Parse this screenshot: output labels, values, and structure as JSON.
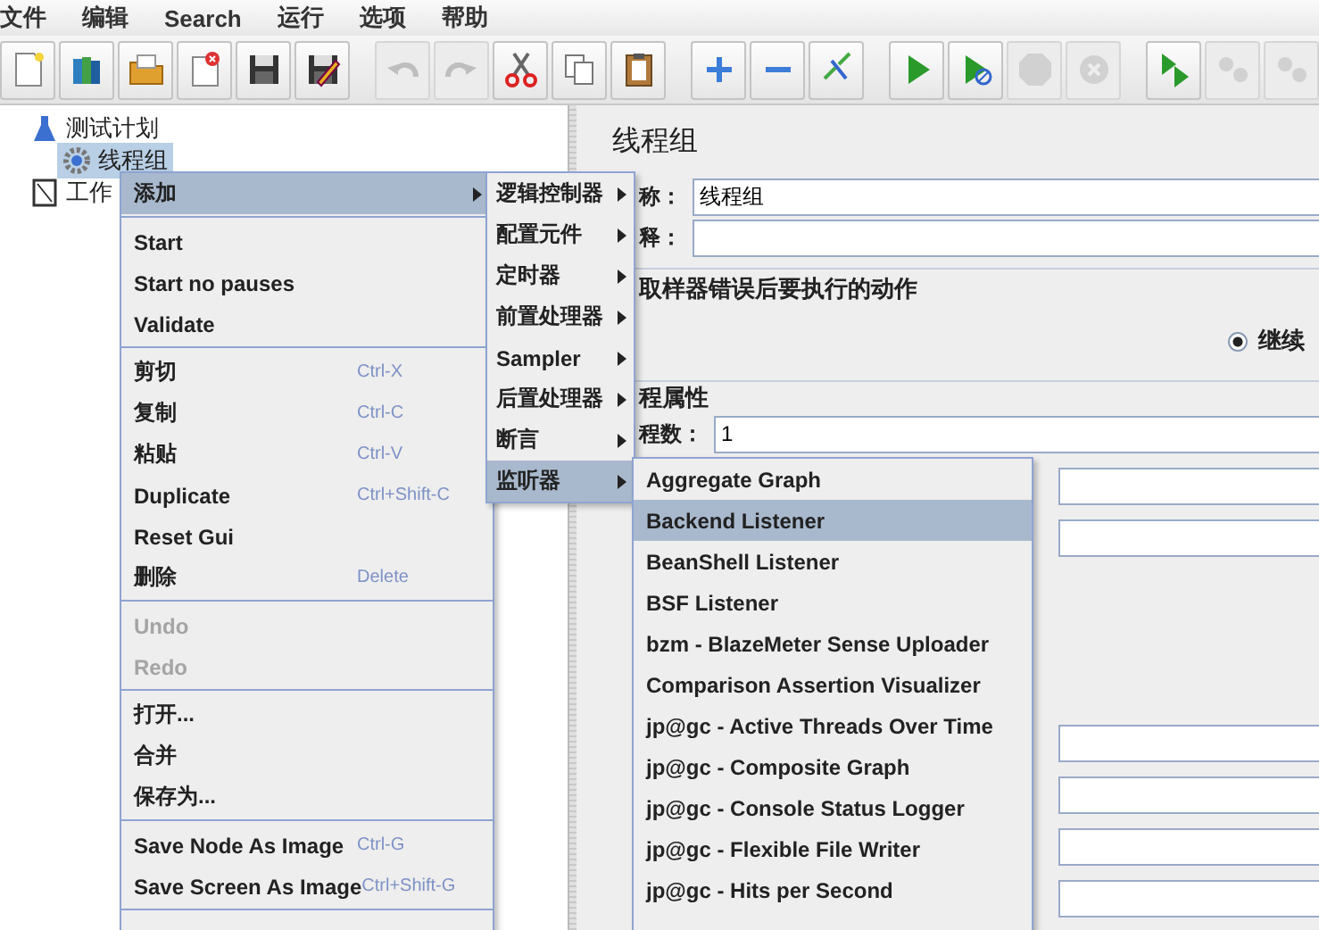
{
  "menu_bar": [
    "文件",
    "编辑",
    "Search",
    "运行",
    "选项",
    "帮助"
  ],
  "toolbar": [
    [
      {
        "kind": "new",
        "disabled": false
      },
      {
        "kind": "templates",
        "disabled": false
      },
      {
        "kind": "open",
        "disabled": false
      },
      {
        "kind": "close",
        "disabled": false
      },
      {
        "kind": "save",
        "disabled": false
      },
      {
        "kind": "save-as",
        "disabled": false
      }
    ],
    [
      {
        "kind": "undo",
        "disabled": true
      },
      {
        "kind": "redo",
        "disabled": true
      },
      {
        "kind": "cut",
        "disabled": false
      },
      {
        "kind": "copy",
        "disabled": false
      },
      {
        "kind": "paste",
        "disabled": false
      }
    ],
    [
      {
        "kind": "expand",
        "disabled": false
      },
      {
        "kind": "collapse",
        "disabled": false
      },
      {
        "kind": "toggle",
        "disabled": false
      }
    ],
    [
      {
        "kind": "start",
        "disabled": false
      },
      {
        "kind": "start-no-pauses",
        "disabled": false
      },
      {
        "kind": "stop",
        "disabled": true
      },
      {
        "kind": "shutdown",
        "disabled": true
      }
    ],
    [
      {
        "kind": "remote-start",
        "disabled": false
      },
      {
        "kind": "remote-stop",
        "disabled": true
      },
      {
        "kind": "remote-exit",
        "disabled": true
      }
    ]
  ],
  "tree": [
    {
      "label": "测试计划",
      "kind": "plan",
      "selected": false,
      "children": [
        {
          "label": "线程组",
          "kind": "thread-group",
          "selected": true
        }
      ]
    },
    {
      "label": "工作",
      "kind": "workbench",
      "selected": false
    }
  ],
  "panel": {
    "title": "线程组",
    "name_label": "称：",
    "name_value": "线程组",
    "comment_label": "释：",
    "error_action": {
      "legend": "取样器错误后要执行的动作",
      "options": [
        {
          "label": "继续",
          "selected": true
        }
      ]
    },
    "thread_properties": {
      "legend": "程属性",
      "threads_label": "程数：",
      "threads_value": "1"
    }
  },
  "context_menu": [
    {
      "kind": "item",
      "label": "添加",
      "submenu": true,
      "selected": true,
      "disabled": false
    },
    {
      "kind": "separator"
    },
    {
      "kind": "item",
      "label": "Start",
      "submenu": false,
      "selected": false,
      "disabled": false
    },
    {
      "kind": "item",
      "label": "Start no pauses",
      "submenu": false,
      "selected": false,
      "disabled": false
    },
    {
      "kind": "item",
      "label": "Validate",
      "submenu": false,
      "selected": false,
      "disabled": false
    },
    {
      "kind": "separator"
    },
    {
      "kind": "item",
      "label": "剪切",
      "shortcut": "Ctrl-X",
      "submenu": false,
      "selected": false,
      "disabled": false
    },
    {
      "kind": "item",
      "label": "复制",
      "shortcut": "Ctrl-C",
      "submenu": false,
      "selected": false,
      "disabled": false
    },
    {
      "kind": "item",
      "label": "粘贴",
      "shortcut": "Ctrl-V",
      "submenu": false,
      "selected": false,
      "disabled": false
    },
    {
      "kind": "item",
      "label": "Duplicate",
      "shortcut": "Ctrl+Shift-C",
      "submenu": false,
      "selected": false,
      "disabled": false
    },
    {
      "kind": "item",
      "label": "Reset Gui",
      "submenu": false,
      "selected": false,
      "disabled": false
    },
    {
      "kind": "item",
      "label": "删除",
      "shortcut": "Delete",
      "submenu": false,
      "selected": false,
      "disabled": false
    },
    {
      "kind": "separator"
    },
    {
      "kind": "item",
      "label": "Undo",
      "submenu": false,
      "selected": false,
      "disabled": true
    },
    {
      "kind": "item",
      "label": "Redo",
      "submenu": false,
      "selected": false,
      "disabled": true
    },
    {
      "kind": "separator"
    },
    {
      "kind": "item",
      "label": "打开...",
      "submenu": false,
      "selected": false,
      "disabled": false
    },
    {
      "kind": "item",
      "label": "合并",
      "submenu": false,
      "selected": false,
      "disabled": false
    },
    {
      "kind": "item",
      "label": "保存为...",
      "submenu": false,
      "selected": false,
      "disabled": false
    },
    {
      "kind": "separator"
    },
    {
      "kind": "item",
      "label": "Save Node As Image",
      "shortcut": "Ctrl-G",
      "submenu": false,
      "selected": false,
      "disabled": false
    },
    {
      "kind": "item",
      "label": "Save Screen As Image",
      "shortcut": "Ctrl+Shift-G",
      "submenu": false,
      "selected": false,
      "disabled": false
    },
    {
      "kind": "separator"
    }
  ],
  "add_submenu": [
    {
      "label": "逻辑控制器",
      "submenu": true,
      "selected": false
    },
    {
      "label": "配置元件",
      "submenu": true,
      "selected": false
    },
    {
      "label": "定时器",
      "submenu": true,
      "selected": false
    },
    {
      "label": "前置处理器",
      "submenu": true,
      "selected": false
    },
    {
      "label": "Sampler",
      "submenu": true,
      "selected": false
    },
    {
      "label": "后置处理器",
      "submenu": true,
      "selected": false
    },
    {
      "label": "断言",
      "submenu": true,
      "selected": false
    },
    {
      "label": "监听器",
      "submenu": true,
      "selected": true
    }
  ],
  "listener_menu": [
    {
      "label": "Aggregate Graph",
      "selected": false
    },
    {
      "label": "Backend Listener",
      "selected": true
    },
    {
      "label": "BeanShell Listener",
      "selected": false
    },
    {
      "label": "BSF Listener",
      "selected": false
    },
    {
      "label": "bzm - BlazeMeter Sense Uploader",
      "selected": false
    },
    {
      "label": "Comparison Assertion Visualizer",
      "selected": false
    },
    {
      "label": "jp@gc - Active Threads Over Time",
      "selected": false
    },
    {
      "label": "jp@gc - Composite Graph",
      "selected": false
    },
    {
      "label": "jp@gc - Console Status Logger",
      "selected": false
    },
    {
      "label": "jp@gc - Flexible File Writer",
      "selected": false
    },
    {
      "label": "jp@gc - Hits per Second",
      "selected": false
    }
  ]
}
